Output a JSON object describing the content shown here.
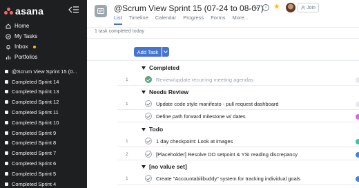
{
  "sidebar": {
    "logo_text": "asana",
    "nav": [
      {
        "label": "Home",
        "icon": "home-icon"
      },
      {
        "label": "My Tasks",
        "icon": "check-circle-icon"
      },
      {
        "label": "Inbox",
        "icon": "bell-icon",
        "badge_color": "#fcbd01"
      },
      {
        "label": "Portfolios",
        "icon": "chart-icon"
      }
    ],
    "projects": [
      "@Scrum View Sprint 15 (0...",
      "Completed Sprint 14",
      "Completed Sprint 13",
      "Completed Sprint 12",
      "Completed Sprint 11",
      "Completed Sprint 10",
      "Completed Sprint 9",
      "Completed Sprint 8",
      "Completed Sprint 7",
      "Completed Sprint 6",
      "Completed Sprint 5",
      "Completed Sprint 4"
    ]
  },
  "header": {
    "title": "@Scrum View Sprint 15 (07-24 to 08-07)",
    "join_label": "Join",
    "tabs": [
      "List",
      "Timeline",
      "Calendar",
      "Progress",
      "Forms",
      "More..."
    ],
    "active_tab": "List"
  },
  "status_line": "1 task completed today",
  "toolbar": {
    "add_task_label": "Add Task"
  },
  "sections": [
    {
      "title": "Completed",
      "tasks": [
        {
          "num": "1",
          "name": "Review/update recurring meeting agendas",
          "done": true,
          "edge_color": "#e8e8ee"
        }
      ]
    },
    {
      "title": "Needs Review",
      "tasks": [
        {
          "num": "1",
          "name": "Update code style manifesto - pull request dashboard",
          "done": false,
          "edge_color": "#e8e8ee"
        },
        {
          "num": "",
          "name": "Define path forward milestone w/ dates",
          "done": false,
          "edge_color": "#e362e3"
        }
      ]
    },
    {
      "title": "Todo",
      "tasks": [
        {
          "num": "1",
          "name": "1 day checkpoint: Look at images",
          "done": false,
          "edge_color": "#37c5ab"
        },
        {
          "num": "2",
          "name": "[Placeholder] Resolve DO setpoint & YSI reading discrepancy",
          "done": false,
          "edge_color": "#4186e0"
        }
      ]
    },
    {
      "title": "[no value set]",
      "tasks": [
        {
          "num": "1",
          "name": "Create \"Accountabilibuddy\" system for tracking individual goals",
          "done": false,
          "edge_color": "#4186e0"
        }
      ]
    }
  ],
  "colors": {
    "sidebar_bg": "#1e1f21",
    "accent": "#4573d2",
    "done_green": "#5da283",
    "logo": "#f06a6a",
    "star": "#fcbd01"
  }
}
